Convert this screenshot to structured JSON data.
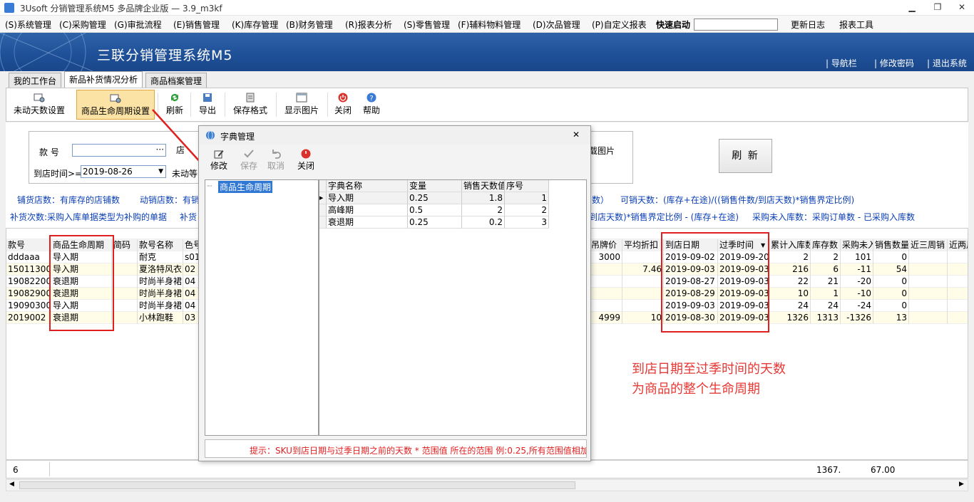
{
  "window": {
    "title": "3Usoft 分销管理系统M5 多品牌企业版 — 3.9_m3kf"
  },
  "menu": [
    "(S)系统管理",
    "(C)采购管理",
    "(G)审批流程",
    "(E)销售管理",
    "(K)库存管理",
    "(B)财务管理",
    "(R)报表分析",
    "(S)零售管理",
    "(F)辅料物料管理",
    "(D)次品管理",
    "(P)自定义报表"
  ],
  "quick_start": "快速启动",
  "menu_right": [
    "更新日志",
    "报表工具"
  ],
  "banner": {
    "title": "三联分销管理系统M5",
    "links": [
      "导航栏",
      "修改密码",
      "退出系统"
    ]
  },
  "tabs": [
    "我的工作台",
    "新品补货情况分析",
    "商品档案管理"
  ],
  "toolbar": [
    "未动天数设置",
    "商品生命周期设置",
    "刷新",
    "导出",
    "保存格式",
    "显示图片",
    "关闭",
    "帮助"
  ],
  "filter": {
    "style_no_label": "款  号",
    "arrival_label": "到店时间>=",
    "arrival_value": "2019-08-26",
    "unmoved_label": "未动等",
    "image_label": "载图片",
    "refresh": "刷 新",
    "info1a": "铺货店数：有库存的店铺数",
    "info1b": "动销店数：有销",
    "info1c": "数）",
    "info1d": "可销天数：(库存+在途)/((销售件数/到店天数)*销售界定比例)",
    "info2a": "补货次数:采购入库单据类型为补购的单据",
    "info2b": "补货",
    "info2c": "到店天数)*销售界定比例 - (库存+在途)",
    "info2d": "采购未入库数：采购订单数 - 已采购入库数"
  },
  "grid": {
    "headers_left": [
      "款号",
      "商品生命周期",
      "简码",
      "款号名称",
      "色号"
    ],
    "headers_right": [
      "吊牌价",
      "平均折扣",
      "到店日期",
      "过季时间",
      "累计入库数",
      "库存数",
      "采购未入",
      "销售数量",
      "近三周销",
      "近两周"
    ],
    "rows": [
      {
        "code": "dddaaa",
        "cycle": "导入期",
        "name": "耐克",
        "color": "s01",
        "price": "3000",
        "discount": "",
        "arrive": "2019-09-02",
        "season": "2019-09-20",
        "inbound": "2",
        "stock": "2",
        "unin": "101",
        "sales": "0"
      },
      {
        "code": "150113002",
        "cycle": "导入期",
        "name": "夏洛特风衣",
        "color": "02",
        "price": "",
        "discount": "7.46",
        "arrive": "2019-09-03",
        "season": "2019-09-03",
        "inbound": "216",
        "stock": "6",
        "unin": "-11",
        "sales": "54"
      },
      {
        "code": "190822002",
        "cycle": "衰退期",
        "name": "时尚半身裙",
        "color": "04",
        "price": "",
        "discount": "",
        "arrive": "2019-08-27",
        "season": "2019-09-03",
        "inbound": "22",
        "stock": "21",
        "unin": "-20",
        "sales": "0"
      },
      {
        "code": "190829001",
        "cycle": "衰退期",
        "name": "时尚半身裙",
        "color": "04",
        "price": "",
        "discount": "",
        "arrive": "2019-08-29",
        "season": "2019-09-03",
        "inbound": "10",
        "stock": "1",
        "unin": "-10",
        "sales": "0"
      },
      {
        "code": "190903003",
        "cycle": "导入期",
        "name": "时尚半身裙",
        "color": "04",
        "price": "",
        "discount": "",
        "arrive": "2019-09-03",
        "season": "2019-09-03",
        "inbound": "24",
        "stock": "24",
        "unin": "-24",
        "sales": "0"
      },
      {
        "code": "2019002",
        "cycle": "衰退期",
        "name": "小林跑鞋",
        "color": "03",
        "price": "4999",
        "discount": "10",
        "arrive": "2019-08-30",
        "season": "2019-09-03",
        "inbound": "1326",
        "stock": "1313",
        "unin": "-1326",
        "sales": "13"
      }
    ],
    "footer": {
      "count": "6",
      "sum1": "1367.",
      "sum2": "67.00"
    }
  },
  "annotation": [
    "到店日期至过季时间的天数",
    "为商品的整个生命周期"
  ],
  "dialog": {
    "title": "字典管理",
    "buttons": [
      "修改",
      "保存",
      "取消",
      "关闭"
    ],
    "tree_item": "商品生命周期",
    "headers": [
      "字典名称",
      "变量",
      "销售天数值",
      "序号"
    ],
    "rows": [
      {
        "name": "导入期",
        "var": "0.25",
        "days": "1.8",
        "seq": "1"
      },
      {
        "name": "高峰期",
        "var": "0.5",
        "days": "2",
        "seq": "2"
      },
      {
        "name": "衰退期",
        "var": "0.25",
        "days": "0.2",
        "seq": "3"
      }
    ],
    "hint": "提示：SKU到店日期与过季日期之前的天数 * 范围值 所在的范围 例:0.25,所有范围值相加"
  },
  "colors": {
    "banner": "#1e4f97",
    "highlight": "#e02020",
    "toolbar_active": "#fbe3a6",
    "info_blue": "#0a3fb5"
  }
}
